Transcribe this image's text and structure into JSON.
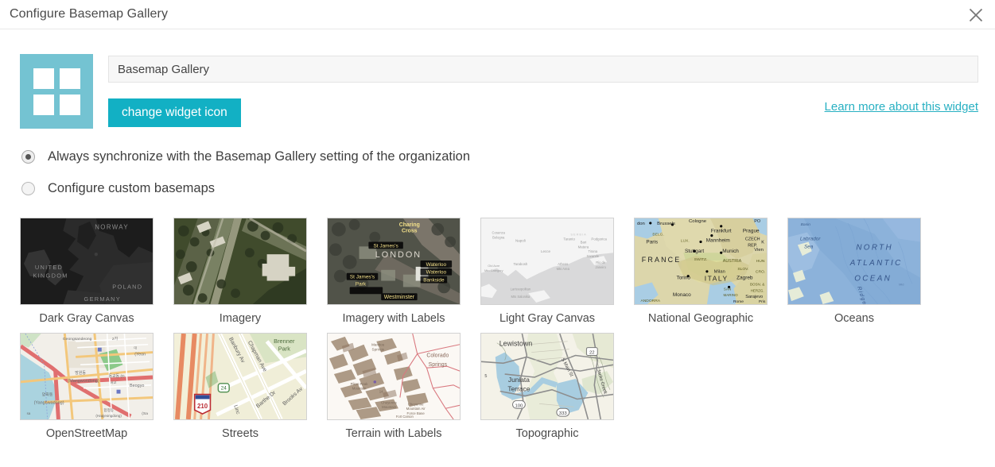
{
  "window": {
    "title": "Configure Basemap Gallery",
    "close_icon": "close-icon"
  },
  "config": {
    "widget_icon_name": "basemap-gallery-widget-icon",
    "name_value": "Basemap Gallery",
    "name_placeholder": "Basemap Gallery",
    "change_icon_label": "change widget icon",
    "learn_more_label": "Learn more about this widget"
  },
  "options": [
    {
      "id": "sync-org",
      "label": "Always synchronize with the Basemap Gallery setting of the organization",
      "selected": true
    },
    {
      "id": "custom",
      "label": "Configure custom basemaps",
      "selected": false
    }
  ],
  "basemaps": [
    {
      "id": "dark-gray-canvas",
      "label": "Dark Gray Canvas",
      "map_labels": [
        "NORWAY",
        "UNITED",
        "KINGDOM",
        "POLAND",
        "GERMANY"
      ]
    },
    {
      "id": "imagery",
      "label": "Imagery",
      "map_labels": []
    },
    {
      "id": "imagery-with-labels",
      "label": "Imagery with Labels",
      "map_labels": [
        "Charing Cross",
        "St James's",
        "LONDON",
        "Waterloo",
        "St James's Park",
        "Westminster"
      ]
    },
    {
      "id": "light-gray-canvas",
      "label": "Light Gray Canvas",
      "map_labels": [
        "Napoli",
        "Taranto",
        "Bari",
        "Podgorica",
        "Tirana",
        "Lecce"
      ]
    },
    {
      "id": "national-geographic",
      "label": "National Geographic",
      "map_labels": [
        "Brussels",
        "Cologne",
        "Frankfurt",
        "Prague",
        "Mannheim",
        "CZECH REP.",
        "Paris",
        "Stuttgart",
        "Munich",
        "Vien",
        "FRANCE",
        "SWITZ.",
        "AUSTRIA",
        "HUN",
        "Milan",
        "ITALY",
        "Zagreb",
        "Torino",
        "SAN MARINO",
        "Sarajevo",
        "Monaco",
        "ANDORRA",
        "BELG.",
        "LUX.",
        "SLOV.",
        "CRO.",
        "BOSN. &",
        "HERZG."
      ]
    },
    {
      "id": "oceans",
      "label": "Oceans",
      "map_labels": [
        "Basin",
        "Labrador Sea",
        "NORTH",
        "ATLANTIC",
        "OCEAN",
        "Ridge"
      ]
    },
    {
      "id": "openstreetmap",
      "label": "OpenStreetMap",
      "map_labels": [
        "(Mangwondong)",
        "(Yanghwadong)",
        "Yeon",
        "Deogyo"
      ]
    },
    {
      "id": "streets",
      "label": "Streets",
      "map_labels": [
        "Banbury Av",
        "Chapman Ave",
        "Brenner Park",
        "Barthe Dr",
        "Brooks Av",
        "24",
        "210",
        "Linc"
      ]
    },
    {
      "id": "terrain-with-labels",
      "label": "Terrain with Labels",
      "map_labels": [
        "Colorado Springs",
        "Manitou Springs",
        "Cheyenne Mountain"
      ]
    },
    {
      "id": "topographic",
      "label": "Topographic",
      "map_labels": [
        "Lewistown",
        "Juniata",
        "Terrace",
        "S Main St",
        "Jacks Creek",
        "22",
        "100",
        "333"
      ]
    }
  ],
  "colors": {
    "accent_teal": "#12b0c4",
    "icon_teal": "#74c3d2",
    "link_teal": "#27b0c2",
    "title_text": "#4a4a4a",
    "body_text": "#3f3f3f",
    "border": "#d2d2d2"
  }
}
